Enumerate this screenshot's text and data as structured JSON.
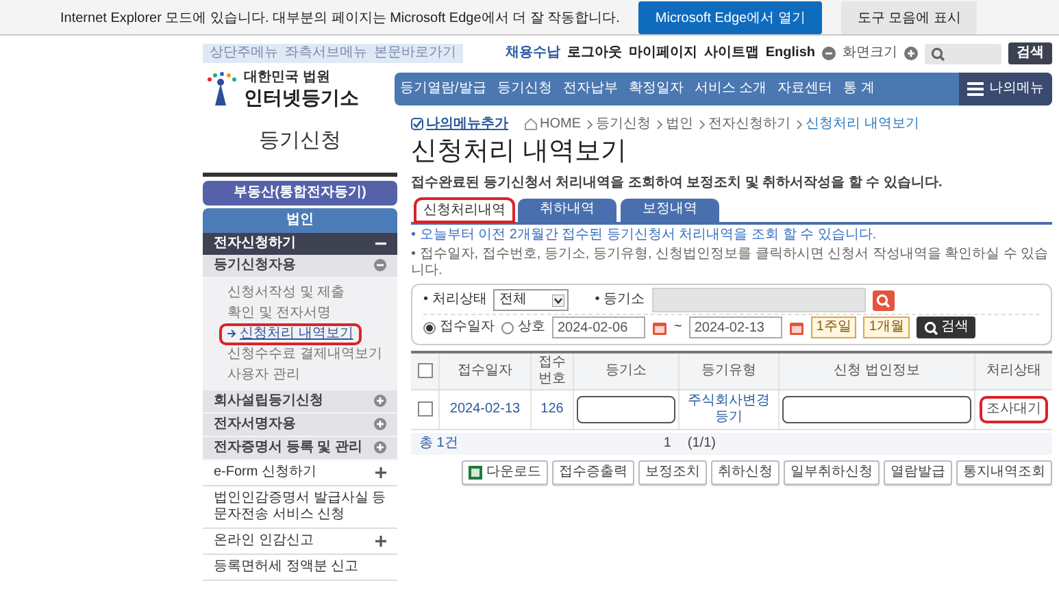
{
  "ie_bar": {
    "message": "Internet Explorer 모드에 있습니다. 대부분의 페이지는 Microsoft Edge에서 더 잘 작동합니다.",
    "buttons": [
      {
        "label": "Microsoft Edge에서 열기",
        "primary": true
      },
      {
        "label": "도구 모음에 표시",
        "primary": false
      }
    ]
  },
  "header": {
    "skip_links": [
      "상단주메뉴",
      "좌측서브메뉴",
      "본문바로가기"
    ],
    "utility_links": [
      {
        "label": "채용수납",
        "emphasized": true
      },
      {
        "label": "로그아웃",
        "emphasized": false
      },
      {
        "label": "마이페이지",
        "emphasized": false
      },
      {
        "label": "사이트맵",
        "emphasized": false
      },
      {
        "label": "English",
        "emphasized": false
      }
    ],
    "zoom_label": "화면크기",
    "search_button": "검색",
    "logo": {
      "subtitle": "대한민국 법원",
      "title": "인터넷등기소"
    },
    "nav": [
      "등기열람/발급",
      "등기신청",
      "전자납부",
      "확정일자",
      "서비스 소개",
      "자료센터",
      "통 계"
    ],
    "my_menu": "나의메뉴"
  },
  "sidebar": {
    "title": "등기신청",
    "top_button": "부동산(통합전자등기)",
    "section": "법인",
    "items": [
      {
        "label": "전자신청하기",
        "expanded": true,
        "children": [
          {
            "label": "등기신청자용",
            "expanded": true,
            "children": [
              {
                "label": "신청서작성 및 제출",
                "selected": false,
                "highlighted": false
              },
              {
                "label": "확인 및 전자서명",
                "selected": false,
                "highlighted": false
              },
              {
                "label": "신청처리 내역보기",
                "selected": true,
                "highlighted": true
              },
              {
                "label": "신청수수료 결제내역보기",
                "selected": false,
                "highlighted": false
              },
              {
                "label": "사용자 관리",
                "selected": false,
                "highlighted": false
              }
            ]
          },
          {
            "label": "회사설립등기신청",
            "expanded": false
          },
          {
            "label": "전자서명자용",
            "expanded": false
          },
          {
            "label": "전자증명서 등록 및 관리",
            "expanded": false
          }
        ]
      },
      {
        "label": "e-Form 신청하기",
        "expanded": false
      },
      {
        "label": "법인인감증명서 발급사실 등 문자전송 서비스 신청"
      },
      {
        "label": "온라인 인감신고",
        "expanded": false
      },
      {
        "label": "등록면허세 정액분 신고"
      }
    ]
  },
  "main": {
    "my_menu_add": "나의메뉴추가",
    "breadcrumb": [
      {
        "label": "HOME",
        "current": false
      },
      {
        "label": "등기신청",
        "current": false
      },
      {
        "label": "법인",
        "current": false
      },
      {
        "label": "전자신청하기",
        "current": false
      },
      {
        "label": "신청처리 내역보기",
        "current": true
      }
    ],
    "title": "신청처리 내역보기",
    "description": "접수완료된 등기신청서 처리내역을 조회하여 보정조치 및 취하서작성을 할 수 있습니다.",
    "tabs": [
      {
        "label": "신청처리내역",
        "selected": true,
        "highlighted": true
      },
      {
        "label": "취하내역",
        "selected": false,
        "highlighted": false
      },
      {
        "label": "보정내역",
        "selected": false,
        "highlighted": false
      }
    ],
    "notes": [
      {
        "text": "• 오늘부터 이전 2개월간 접수된 등기신청서 처리내역을 조회 할 수 있습니다.",
        "kind": "info"
      },
      {
        "text": "• 접수일자, 접수번호, 등기소, 등기유형, 신청법인정보를 클릭하시면 신청서 작성내역을 확인하실 수 있습니다.",
        "kind": "plain"
      }
    ],
    "filter": {
      "status_label": "• 처리상태",
      "status_value": "전체",
      "office_label": "• 등기소",
      "radios": [
        {
          "label": "접수일자",
          "selected": true
        },
        {
          "label": "상호",
          "selected": false
        }
      ],
      "date_from": "2024-02-06",
      "date_sep": "~",
      "date_to": "2024-02-13",
      "periods": [
        "1주일",
        "1개월"
      ],
      "search_button": "검색"
    },
    "table": {
      "header_checked": false,
      "columns": [
        "접수일자",
        "접수번호",
        "등기소",
        "등기유형",
        "신청 법인정보",
        "처리상태"
      ],
      "rows": [
        {
          "checked": false,
          "date": "2024-02-13",
          "number": "126",
          "type": "주식회사변경등기",
          "status": "조사대기",
          "status_highlighted": true
        }
      ]
    },
    "pager": {
      "total": "총 1건",
      "page": "1",
      "pages": "(1/1)"
    },
    "actions": [
      {
        "label": "다운로드",
        "kind": "spreadsheet"
      },
      {
        "label": "접수증출력",
        "kind": "plain"
      },
      {
        "label": "보정조치",
        "kind": "plain"
      },
      {
        "label": "취하신청",
        "kind": "plain"
      },
      {
        "label": "일부취하신청",
        "kind": "plain"
      },
      {
        "label": "열람발급",
        "kind": "plain"
      },
      {
        "label": "통지내역조회",
        "kind": "plain"
      }
    ]
  }
}
